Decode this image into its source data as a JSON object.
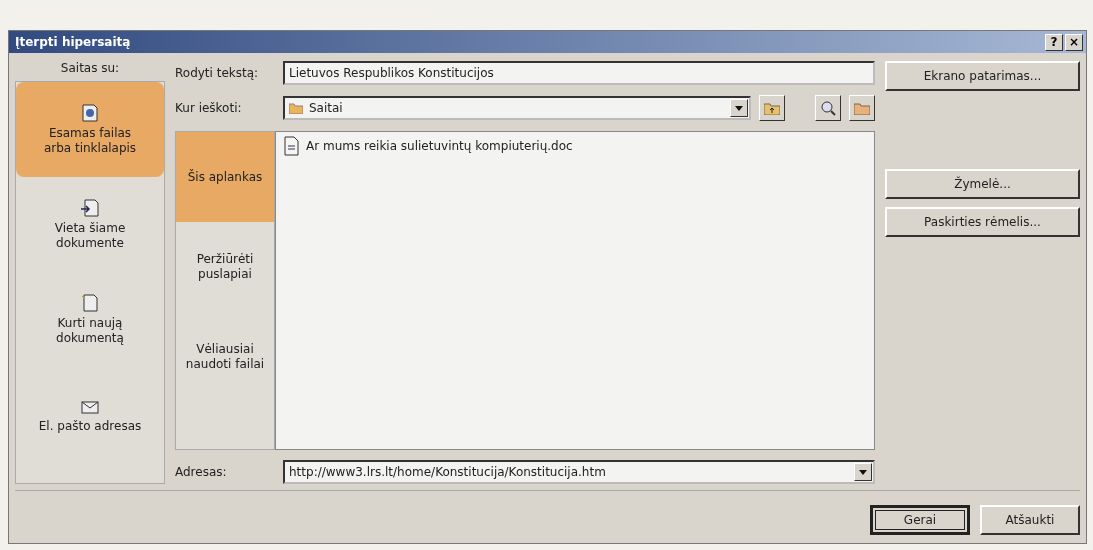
{
  "window": {
    "title": "Įterpti hipersaitą",
    "help": "?",
    "close": "×"
  },
  "link_to": {
    "label": "Saitas su:",
    "items": [
      {
        "kind": "file",
        "label": "Esamas failas arba tinklalapis",
        "selected": true
      },
      {
        "kind": "place",
        "label": "Vieta šiame dokumente",
        "selected": false
      },
      {
        "kind": "new",
        "label": "Kurti naują dokumentą",
        "selected": false
      },
      {
        "kind": "mail",
        "label": "El. pašto adresas",
        "selected": false
      }
    ]
  },
  "display_text": {
    "label": "Rodyti tekstą:",
    "value": "Lietuvos Respublikos Konstitucijos"
  },
  "look_in": {
    "label": "Kur ieškoti:",
    "value": "Saitai"
  },
  "views": [
    {
      "label": "Šis aplankas",
      "selected": true
    },
    {
      "label": "Peržiūrėti puslapiai",
      "selected": false
    },
    {
      "label": "Vėliausiai naudoti failai",
      "selected": false
    }
  ],
  "files": [
    {
      "name": "Ar mums reikia sulietuvintų kompiuterių.doc"
    }
  ],
  "address": {
    "label": "Adresas:",
    "value": "http://www3.lrs.lt/home/Konstitucija/Konstitucija.htm"
  },
  "side_buttons": [
    "Ekrano patarimas...",
    "Žymelė...",
    "Paskirties rėmelis..."
  ],
  "buttons": [
    {
      "label": "Gerai",
      "default": true
    },
    {
      "label": "Atšaukti",
      "default": false
    }
  ]
}
